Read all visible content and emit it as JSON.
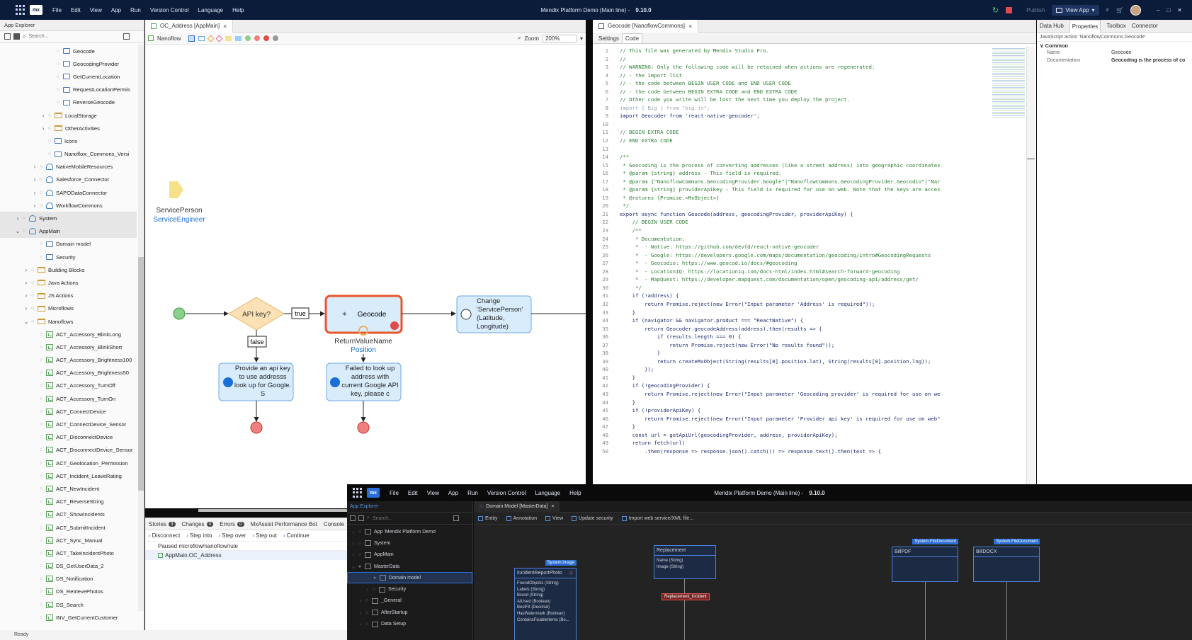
{
  "window": {
    "title": "Mendix Platform Demo (Main line)",
    "version": "9.10.0",
    "menu": [
      "File",
      "Edit",
      "View",
      "App",
      "Run",
      "Version Control",
      "Language",
      "Help"
    ],
    "publish": "Publish",
    "view_app": "View App",
    "status": "Ready"
  },
  "app_explorer": {
    "title": "App Explorer",
    "search_placeholder": "Search...",
    "items": [
      {
        "label": "Geocode",
        "indent": 6,
        "icon": "file"
      },
      {
        "label": "GeocodingProvider",
        "indent": 6,
        "icon": "enum"
      },
      {
        "label": "GetCurrentLocation",
        "indent": 6,
        "icon": "file"
      },
      {
        "label": "RequestLocationPermis",
        "indent": 6,
        "icon": "file"
      },
      {
        "label": "ReverseGeocode",
        "indent": 6,
        "icon": "file"
      },
      {
        "label": "LocalStorage",
        "indent": 5,
        "icon": "folder",
        "caret": ">"
      },
      {
        "label": "OtherActivities",
        "indent": 5,
        "icon": "folder",
        "caret": ">"
      },
      {
        "label": "Icons",
        "indent": 5,
        "icon": "file"
      },
      {
        "label": "Nanoflow_Commons_Versi",
        "indent": 5,
        "icon": "const"
      },
      {
        "label": "NativeMobileResources",
        "indent": 4,
        "icon": "module",
        "caret": ">"
      },
      {
        "label": "Salesforce_Connector",
        "indent": 4,
        "icon": "module",
        "caret": ">"
      },
      {
        "label": "SAPODataConnector",
        "indent": 4,
        "icon": "module",
        "caret": ">"
      },
      {
        "label": "WorkflowCommons",
        "indent": 4,
        "icon": "module",
        "caret": ">"
      },
      {
        "label": "System",
        "indent": 2,
        "icon": "module",
        "caret": ">"
      },
      {
        "label": "AppMain",
        "indent": 2,
        "icon": "module",
        "caret": "v"
      },
      {
        "label": "Domain model",
        "indent": 4,
        "icon": "domain"
      },
      {
        "label": "Security",
        "indent": 4,
        "icon": "security"
      },
      {
        "label": "Building Blocks",
        "indent": 3,
        "icon": "folder",
        "caret": ">"
      },
      {
        "label": "Java Actions",
        "indent": 3,
        "icon": "folder",
        "caret": ">"
      },
      {
        "label": "JS Actions",
        "indent": 3,
        "icon": "folder",
        "caret": ">"
      },
      {
        "label": "Microflows",
        "indent": 3,
        "icon": "folder",
        "caret": ">"
      },
      {
        "label": "Nanoflows",
        "indent": 3,
        "icon": "folder",
        "caret": "v"
      },
      {
        "label": "ACT_Accessory_BlinkLong",
        "indent": 4,
        "icon": "flow"
      },
      {
        "label": "ACT_Accessory_BlinkShort",
        "indent": 4,
        "icon": "flow"
      },
      {
        "label": "ACT_Accessory_Brightness100",
        "indent": 4,
        "icon": "flow"
      },
      {
        "label": "ACT_Accessory_Brightness50",
        "indent": 4,
        "icon": "flow"
      },
      {
        "label": "ACT_Accessory_TurnOff",
        "indent": 4,
        "icon": "flow"
      },
      {
        "label": "ACT_Accessory_TurnOn",
        "indent": 4,
        "icon": "flow"
      },
      {
        "label": "ACT_ConnectDevice",
        "indent": 4,
        "icon": "flow"
      },
      {
        "label": "ACT_ConnectDevice_Sensor",
        "indent": 4,
        "icon": "flow"
      },
      {
        "label": "ACT_DisconnectDevice",
        "indent": 4,
        "icon": "flow"
      },
      {
        "label": "ACT_DisconnectDevice_Sensor",
        "indent": 4,
        "icon": "flow"
      },
      {
        "label": "ACT_Geolocation_Permission",
        "indent": 4,
        "icon": "flow"
      },
      {
        "label": "ACT_Incident_LeaveRating",
        "indent": 4,
        "icon": "flow"
      },
      {
        "label": "ACT_NewIncident",
        "indent": 4,
        "icon": "flow"
      },
      {
        "label": "ACT_ReverseString",
        "indent": 4,
        "icon": "flow"
      },
      {
        "label": "ACT_ShowIncidents",
        "indent": 4,
        "icon": "flow"
      },
      {
        "label": "ACT_SubmitIncident",
        "indent": 4,
        "icon": "flow"
      },
      {
        "label": "ACT_Sync_Manual",
        "indent": 4,
        "icon": "flow"
      },
      {
        "label": "ACT_TakeIncidentPhoto",
        "indent": 4,
        "icon": "flow"
      },
      {
        "label": "DS_GetUserData_2",
        "indent": 4,
        "icon": "flow"
      },
      {
        "label": "DS_Notification",
        "indent": 4,
        "icon": "flow"
      },
      {
        "label": "DS_RetrievePhotos",
        "indent": 4,
        "icon": "flow"
      },
      {
        "label": "DS_Search",
        "indent": 4,
        "icon": "flow"
      },
      {
        "label": "INV_GetCurrentCustomer",
        "indent": 4,
        "icon": "flow"
      }
    ]
  },
  "nanoflow_editor": {
    "tab": "OC_Address [AppMain]",
    "toolbar_label": "Nanoflow",
    "zoom_label": "Zoom",
    "zoom_value": "200%",
    "param_name": "ServicePerson",
    "param_type": "ServiceEngineer",
    "decision": "API key?",
    "true_label": "true",
    "false_label": "false",
    "action_title": "Geocode",
    "return_name": "ReturnValueName",
    "return_var": "Position",
    "change_object": "Change 'ServicePerson' (Latitude, Longitude)",
    "annotation_1": "Provide an api key to use addresss look up for Google. S",
    "annotation_2": "Failed to look up address with current Google API key, please c"
  },
  "debugger": {
    "tabs": [
      {
        "label": "Stories",
        "count": "3"
      },
      {
        "label": "Changes",
        "count": "0"
      },
      {
        "label": "Errors",
        "count": "0"
      },
      {
        "label": "MxAssist Performance Bot",
        "count": ""
      },
      {
        "label": "Console",
        "count": ""
      }
    ],
    "buttons": [
      "Disconnect",
      "Step into",
      "Step over",
      "Step out",
      "Continue"
    ],
    "rows": [
      "Paused microflow/nanoflow/rule",
      "AppMain.OC_Address"
    ]
  },
  "code_editor": {
    "tab": "Geocode [NanoflowCommons]",
    "subtabs": [
      "Settings",
      "Code"
    ],
    "lines": [
      "// This file was generated by Mendix Studio Pro.",
      "//",
      "// WARNING: Only the following code will be retained when actions are regenerated:",
      "// - the import list",
      "// - the code between BEGIN USER CODE and END USER CODE",
      "// - the code between BEGIN EXTRA CODE and END EXTRA CODE",
      "// Other code you write will be lost the next time you deploy the project.",
      "import { Big } from \"big.js\";",
      "import Geocoder from 'react-native-geocoder';",
      "",
      "// BEGIN EXTRA CODE",
      "// END EXTRA CODE",
      "",
      "/**",
      " * Geocoding is the process of converting addresses (like a street address) into geographic coordinates",
      " * @param {string} address - This field is required.",
      " * @param {\"NanoflowCommons.GeocodingProvider.Google\"|\"NanoflowCommons.GeocodingProvider.Geocodio\"|\"Nar",
      " * @param {string} providerApiKey - This field is required for use on web. Note that the keys are acces",
      " * @returns {Promise.<MxObject>}",
      " */",
      "export async function Geocode(address, geocodingProvider, providerApiKey) {",
      "    // BEGIN USER CODE",
      "    /**",
      "     * Documentation:",
      "     *  - Native: https://github.com/devfd/react-native-geocoder",
      "     *  - Google: https://developers.google.com/maps/documentation/geocoding/intro#GeocodingRequests",
      "     *  - Geocodio: https://www.geocod.io/docs/#geocoding",
      "     *  - LocationIQ: https://locationiq.com/docs-html/index.html#search-forward-geocoding",
      "     *  - MapQuest: https://developer.mapquest.com/documentation/open/geocoding-api/address/get/",
      "     */",
      "    if (!address) {",
      "        return Promise.reject(new Error(\"Input parameter 'Address' is required\"));",
      "    }",
      "    if (navigator && navigator.product === \"ReactNative\") {",
      "        return Geocoder.geocodeAddress(address).then(results => {",
      "            if (results.length === 0) {",
      "                return Promise.reject(new Error(\"No results found\"));",
      "            }",
      "            return createMxObject(String(results[0].position.lat), String(results[0].position.lng));",
      "        });",
      "    }",
      "    if (!geocodingProvider) {",
      "        return Promise.reject(new Error(\"Input parameter 'Geocoding provider' is required for use on we",
      "    }",
      "    if (!providerApiKey) {",
      "        return Promise.reject(new Error(\"Input parameter 'Provider api key' is required for use on web\"",
      "    }",
      "    const url = getApiUrl(geocodingProvider, address, providerApiKey);",
      "    return fetch(url)",
      "        .then(response => response.json().catch(() => response.text().then(text => {"
    ]
  },
  "properties": {
    "tabs": [
      "Data Hub",
      "Properties",
      "Toolbox",
      "Connector"
    ],
    "subtitle": "JavaScript action 'NanoflowCommons.Geocode'",
    "section": "Common",
    "rows": [
      {
        "key": "Name",
        "value": "Geocode"
      },
      {
        "key": "Documentation",
        "value": "Geocoding is the process of co"
      }
    ]
  },
  "second_window": {
    "title": "Mendix Platform Demo (Main line)",
    "version": "9.10.0",
    "menu": [
      "File",
      "Edit",
      "View",
      "App",
      "Run",
      "Version Control",
      "Language",
      "Help"
    ],
    "explorer_title": "App Explorer",
    "search_placeholder": "Search...",
    "tree": [
      {
        "label": "App 'Mendix Platform Demo'",
        "indent": 0
      },
      {
        "label": "System",
        "indent": 0
      },
      {
        "label": "AppMain",
        "indent": 0
      },
      {
        "label": "MasterData",
        "indent": 0,
        "caret": "v"
      },
      {
        "label": "Domain model",
        "indent": 2,
        "sel": true
      },
      {
        "label": "Security",
        "indent": 2
      },
      {
        "label": "_General",
        "indent": 1
      },
      {
        "label": "AfterStartup",
        "indent": 1
      },
      {
        "label": "Data Setup",
        "indent": 1
      }
    ],
    "tab": "Domain Model [MasterData]",
    "toolbar": [
      "Entity",
      "Annotation",
      "View",
      "Update security",
      "Import web service/XML file..."
    ],
    "entity1": {
      "badge": "System.Image",
      "name": "IncidentReportPhoto",
      "attrs": [
        "FoundObjects (String)",
        "Labels (String)",
        "Brand (String)",
        "AtUsed (Boolean)",
        "BestFit (Decimal)",
        "HasWatermark (Boolean)",
        "ContainsFixableItems (Bo..."
      ]
    },
    "entity2": {
      "name": "Replacement",
      "attrs": [
        "Name (String)",
        "Image (String)"
      ]
    },
    "assoc": "Replacement_Incident",
    "entity3": {
      "badge": "System.FileDocument",
      "name": "BillPDF"
    },
    "entity4": {
      "badge": "System.FileDocument",
      "name": "BillDOCX"
    }
  },
  "colors": {
    "titlebar": "#0b1b3a",
    "accent": "#2b6fd6",
    "decision": "#f9dca8",
    "action": "#d9ecfb",
    "selected_border": "#e8572c",
    "start": "#8bd08b",
    "end": "#f08080"
  }
}
